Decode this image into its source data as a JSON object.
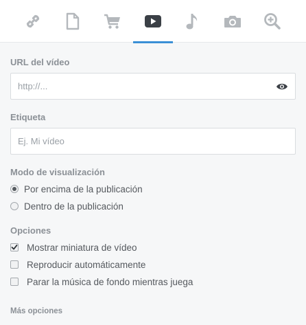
{
  "tabs": [
    {
      "icon": "link-icon",
      "active": false
    },
    {
      "icon": "document-icon",
      "active": false
    },
    {
      "icon": "cart-icon",
      "active": false
    },
    {
      "icon": "video-play-icon",
      "active": true
    },
    {
      "icon": "music-note-icon",
      "active": false
    },
    {
      "icon": "camera-icon",
      "active": false
    },
    {
      "icon": "zoom-in-icon",
      "active": false
    }
  ],
  "url": {
    "label": "URL del vídeo",
    "value": "",
    "placeholder": "http://..."
  },
  "tag": {
    "label": "Etiqueta",
    "value": "",
    "placeholder": "Ej. Mi vídeo"
  },
  "display_mode": {
    "label": "Modo de visualización",
    "options": [
      {
        "label": "Por encima de la publicación",
        "checked": true
      },
      {
        "label": "Dentro de la publicación",
        "checked": false
      }
    ]
  },
  "options": {
    "label": "Opciones",
    "items": [
      {
        "label": "Mostrar miniatura de vídeo",
        "checked": true
      },
      {
        "label": "Reproducir automáticamente",
        "checked": false
      },
      {
        "label": "Parar la música de fondo mientras juega",
        "checked": false
      }
    ]
  },
  "more_options": "Más opciones",
  "colors": {
    "accent": "#3a8fd6",
    "icon": "#b4b8bc",
    "icon_active": "#3b4046"
  }
}
